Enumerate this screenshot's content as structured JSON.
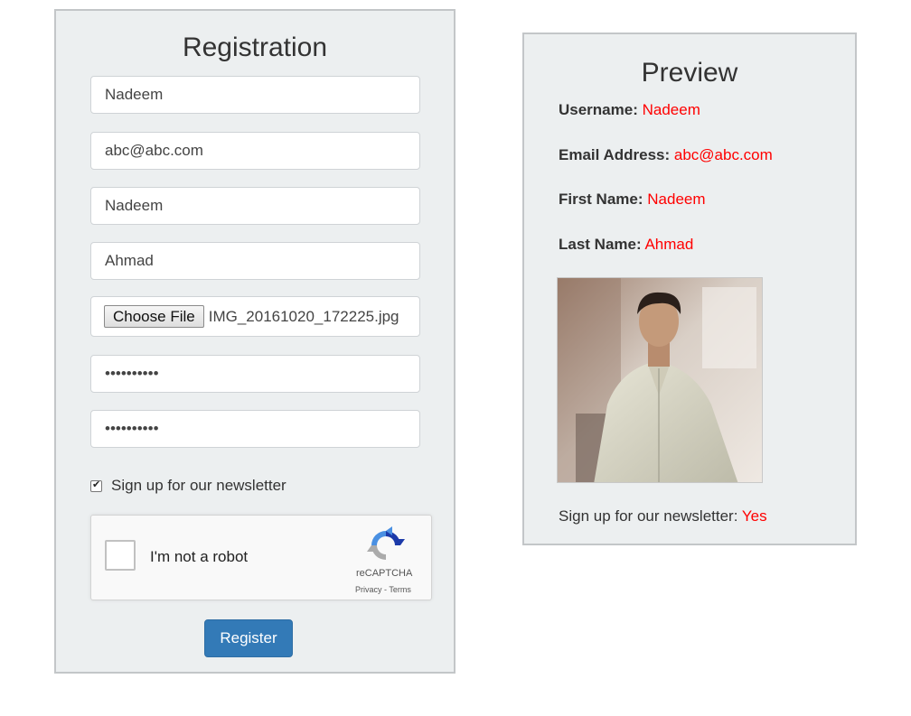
{
  "registration": {
    "title": "Registration",
    "username_value": "Nadeem",
    "email_value": "abc@abc.com",
    "first_name_value": "Nadeem",
    "last_name_value": "Ahmad",
    "choose_file_label": "Choose File",
    "file_name": "IMG_20161020_172225.jpg",
    "password_value": "••••••••••",
    "confirm_password_value": "••••••••••",
    "newsletter_label": "Sign up for our newsletter",
    "newsletter_checked": true,
    "captcha": {
      "label": "I'm not a robot",
      "brand": "reCAPTCHA",
      "links": "Privacy - Terms"
    },
    "register_label": "Register"
  },
  "preview": {
    "title": "Preview",
    "username_label": "Username:",
    "username_value": "Nadeem",
    "email_label": "Email Address:",
    "email_value": "abc@abc.com",
    "first_name_label": "First Name:",
    "first_name_value": "Nadeem",
    "last_name_label": "Last Name:",
    "last_name_value": "Ahmad",
    "newsletter_label": "Sign up for our newsletter:",
    "newsletter_value": "Yes"
  },
  "colors": {
    "panel_bg": "#eceff0",
    "accent_button": "#337ab7",
    "preview_value": "#ff0000"
  }
}
